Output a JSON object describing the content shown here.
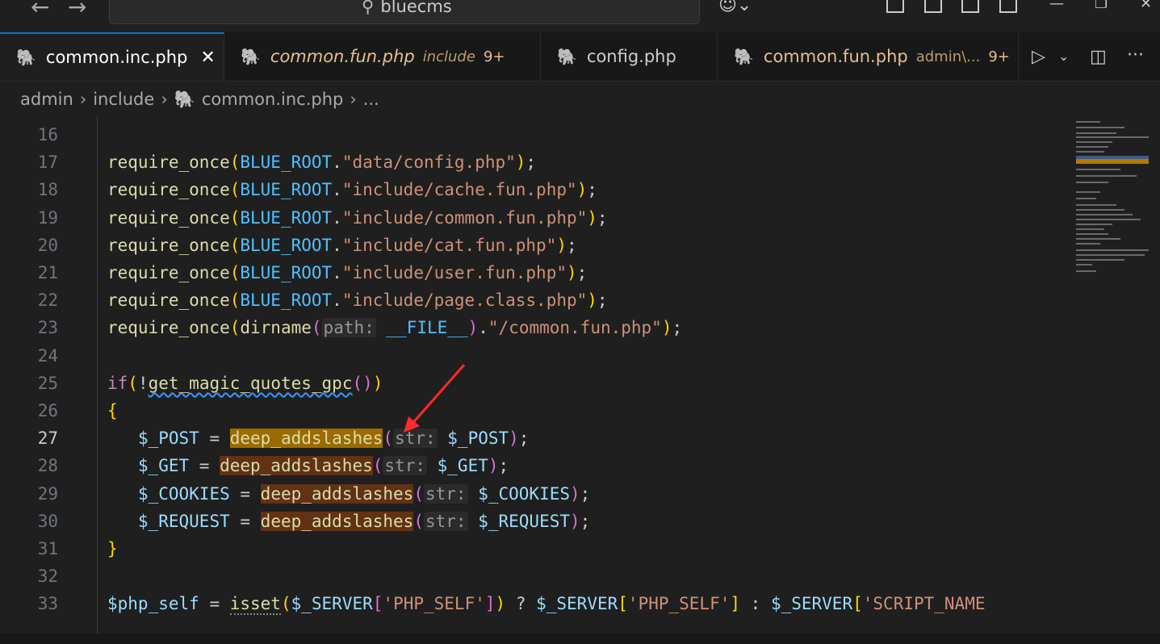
{
  "titlebar": {
    "search_text": "bluecms",
    "back_icon": "arrow-left-icon",
    "forward_icon": "arrow-right-icon",
    "search_icon": "search-icon",
    "copilot_icon": "copilot-icon"
  },
  "tabs": [
    {
      "name": "common.inc.php",
      "desc": "",
      "count": "",
      "active": true
    },
    {
      "name": "common.fun.php",
      "desc": "include",
      "count": "9+",
      "active": false
    },
    {
      "name": "config.php",
      "desc": "",
      "count": "",
      "active": false
    },
    {
      "name": "common.fun.php",
      "desc": "admin\\...",
      "count": "9+",
      "active": false
    }
  ],
  "breadcrumb": {
    "parts": [
      "admin",
      "include",
      "common.inc.php",
      "..."
    ]
  },
  "editor": {
    "current_line": 27,
    "lines": [
      16,
      17,
      18,
      19,
      20,
      21,
      22,
      23,
      24,
      25,
      26,
      27,
      28,
      29,
      30,
      31,
      32,
      33
    ],
    "code": {
      "l17_str": "\"data/config.php\"",
      "l18_str": "\"include/cache.fun.php\"",
      "l19_str": "\"include/common.fun.php\"",
      "l20_str": "\"include/cat.fun.php\"",
      "l21_str": "\"include/user.fun.php\"",
      "l22_str": "\"include/page.class.php\"",
      "l23_str": "\"/common.fun.php\"",
      "fn_require": "require_once",
      "const_root": "BLUE_ROOT",
      "fn_dirname": "dirname",
      "hint_path": "path:",
      "const_file": "__FILE__",
      "kw_if": "if",
      "fn_gpc": "get_magic_quotes_gpc",
      "fn_deep": "deep_addslashes",
      "hint_str": "str:",
      "var_post": "$_POST",
      "var_get": "$_GET",
      "var_cookies": "$_COOKIES",
      "var_request": "$_REQUEST",
      "var_php_self": "$php_self",
      "fn_isset": "isset",
      "var_server": "$_SERVER",
      "str_php_self": "'PHP_SELF'",
      "str_script_name": "'SCRIPT_NAME"
    }
  }
}
